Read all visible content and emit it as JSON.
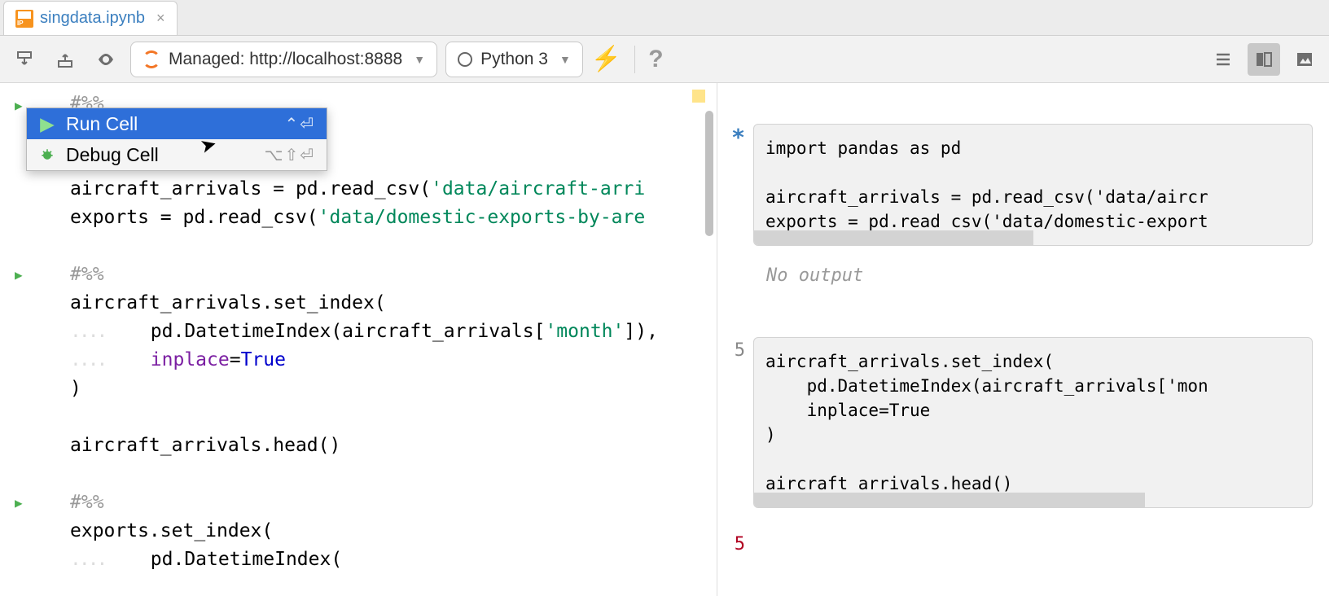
{
  "tab": {
    "filename": "singdata.ipynb"
  },
  "toolbar": {
    "managed_label": "Managed: http://localhost:8888",
    "kernel_label": "Python 3"
  },
  "context_menu": {
    "run_cell": "Run Cell",
    "run_cell_shortcut": "⌃⏎",
    "debug_cell": "Debug Cell",
    "debug_cell_shortcut": "⌥⇧⏎"
  },
  "editor": {
    "line1": "#%%",
    "line4a": "aircraft_arrivals = pd.read_csv(",
    "line4b": "'data/aircraft-arri",
    "line5a": "exports = pd.read_csv(",
    "line5b": "'data/domestic-exports-by-are",
    "line7": "#%%",
    "line8": "aircraft_arrivals.set_index(",
    "line9a": "    pd.DatetimeIndex(aircraft_arrivals[",
    "line9b": "'month'",
    "line9c": "]),",
    "line10a": "    ",
    "line10b": "inplace",
    "line10c": "=",
    "line10d": "True",
    "line11": ")",
    "line13": "aircraft_arrivals.head()",
    "line15": "#%%",
    "line16": "exports.set_index(",
    "line17": "    pd.DatetimeIndex("
  },
  "right": {
    "cell1_marker": "*",
    "cell1_line1": "import pandas as pd",
    "cell1_line3": "aircraft_arrivals = pd.read_csv('data/aircr",
    "cell1_line4": "exports = pd.read_csv('data/domestic-export",
    "no_output": "No output",
    "cell2_num": "5",
    "cell2_line1": "aircraft_arrivals.set_index(",
    "cell2_line2": "    pd.DatetimeIndex(aircraft_arrivals['mon",
    "cell2_line3": "    inplace=True",
    "cell2_line4": ")",
    "cell2_line6": "aircraft_arrivals.head()",
    "cell3_num": "5"
  }
}
